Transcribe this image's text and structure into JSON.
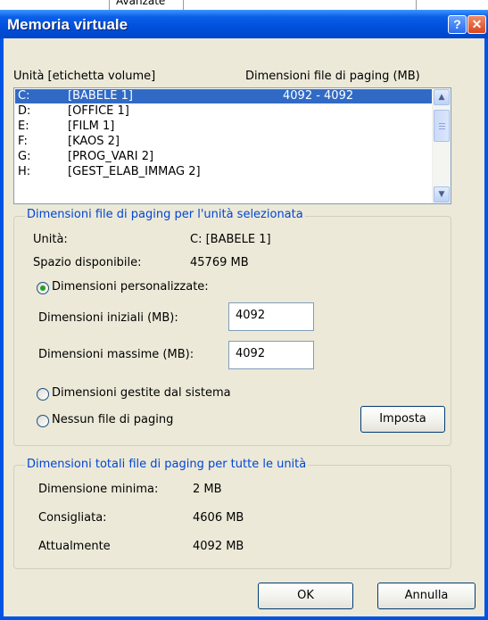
{
  "window": {
    "title": "Memoria virtuale"
  },
  "titlebar_buttons": {
    "help": "?",
    "close": "✕"
  },
  "partial_top_text": "Avanzate",
  "list": {
    "header_drive": "Unità [etichetta volume]",
    "header_size": "Dimensioni file di paging (MB)",
    "rows": [
      {
        "drive": "C:",
        "label": "[BABELE 1]",
        "size": "4092 - 4092",
        "selected": true
      },
      {
        "drive": "D:",
        "label": "[OFFICE 1]",
        "size": ""
      },
      {
        "drive": "E:",
        "label": "[FILM 1]",
        "size": ""
      },
      {
        "drive": "F:",
        "label": "[KAOS 2]",
        "size": ""
      },
      {
        "drive": "G:",
        "label": "[PROG_VARI 2]",
        "size": ""
      },
      {
        "drive": "H:",
        "label": "[GEST_ELAB_IMMAG 2]",
        "size": ""
      }
    ]
  },
  "selected_group": {
    "title": "Dimensioni file di paging per l'unità selezionata",
    "drive_label": "Unità:",
    "drive_value": "C:  [BABELE 1]",
    "space_label": "Spazio disponibile:",
    "space_value": "45769 MB",
    "custom_label": "Dimensioni personalizzate:",
    "initial_label": "Dimensioni iniziali (MB):",
    "initial_value": "4092",
    "max_label": "Dimensioni massime (MB):",
    "max_value": "4092",
    "system_label": "Dimensioni gestite dal sistema",
    "none_label": "Nessun file di paging",
    "set_button": "Imposta",
    "selected_option": "custom"
  },
  "total_group": {
    "title": "Dimensioni totali file di paging per tutte le unità",
    "min_label": "Dimensione minima:",
    "min_value": "2 MB",
    "rec_label": "Consigliata:",
    "rec_value": "4606 MB",
    "cur_label": "Attualmente",
    "cur_value": "4092 MB"
  },
  "buttons": {
    "ok": "OK",
    "cancel": "Annulla"
  },
  "colors": {
    "titlebar": "#0054e3",
    "selection": "#316ac5",
    "group_title": "#0046d5",
    "radio_dot": "#21a121"
  }
}
